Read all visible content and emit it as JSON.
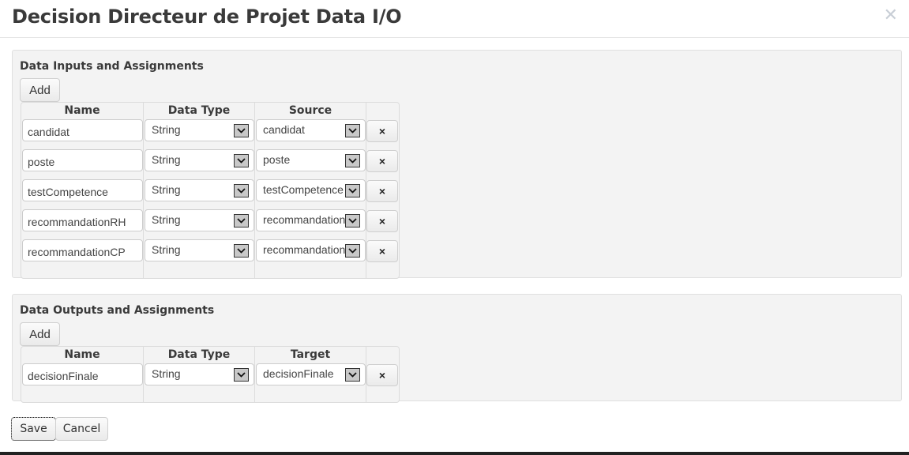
{
  "dialog": {
    "title": "Decision Directeur de Projet Data I/O",
    "close_icon": "close-icon"
  },
  "inputs": {
    "title": "Data Inputs and Assignments",
    "add_label": "Add",
    "columns": [
      "Name",
      "Data Type",
      "Source"
    ],
    "rows": [
      {
        "name": "candidat",
        "type": "String",
        "source": "candidat"
      },
      {
        "name": "poste",
        "type": "String",
        "source": "poste"
      },
      {
        "name": "testCompetence",
        "type": "String",
        "source": "testCompetence"
      },
      {
        "name": "recommandationRH",
        "type": "String",
        "source": "recommandationRH"
      },
      {
        "name": "recommandationCP",
        "type": "String",
        "source": "recommandationCP"
      }
    ]
  },
  "outputs": {
    "title": "Data Outputs and Assignments",
    "add_label": "Add",
    "columns": [
      "Name",
      "Data Type",
      "Target"
    ],
    "rows": [
      {
        "name": "decisionFinale",
        "type": "String",
        "target": "decisionFinale"
      }
    ]
  },
  "footer": {
    "save_label": "Save",
    "cancel_label": "Cancel"
  },
  "icons": {
    "delete": "×",
    "dropdown": "chevron-down-icon"
  }
}
